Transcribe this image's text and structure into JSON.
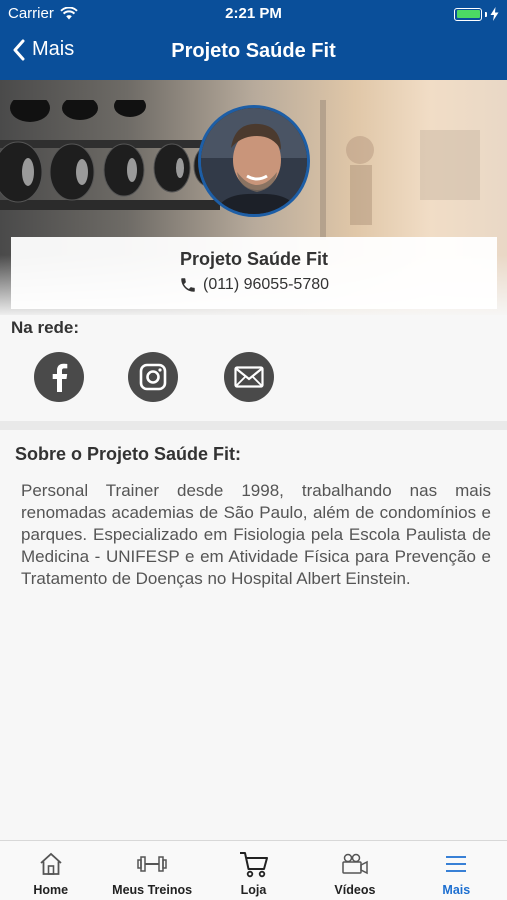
{
  "status": {
    "carrier": "Carrier",
    "time": "2:21 PM"
  },
  "nav": {
    "back_label": "Mais",
    "title": "Projeto Saúde Fit"
  },
  "profile": {
    "name": "Projeto Saúde Fit",
    "phone": "(011) 96055-5780"
  },
  "social": {
    "heading": "Na rede:",
    "items": [
      "facebook-icon",
      "instagram-icon",
      "email-icon"
    ]
  },
  "about": {
    "title": "Sobre o Projeto Saúde Fit:",
    "text": "Personal Trainer desde 1998, trabalhando nas mais renomadas academias de São Paulo, além de condomínios e parques. Especializado em Fisiologia pela Escola Paulista de Medicina - UNIFESP e em Atividade Física para Prevenção e Tratamento de Doenças no Hospital Albert Einstein."
  },
  "tabs": [
    {
      "label": "Home",
      "icon": "home-icon"
    },
    {
      "label": "Meus Treinos",
      "icon": "dumbbell-icon"
    },
    {
      "label": "Loja",
      "icon": "cart-icon"
    },
    {
      "label": "Vídeos",
      "icon": "video-camera-icon"
    },
    {
      "label": "Mais",
      "icon": "menu-icon"
    }
  ],
  "colors": {
    "nav": "#0a4f9a",
    "active_tab": "#1d6fd0",
    "social_bg": "#4a4a4a",
    "battery": "#4cd964"
  }
}
